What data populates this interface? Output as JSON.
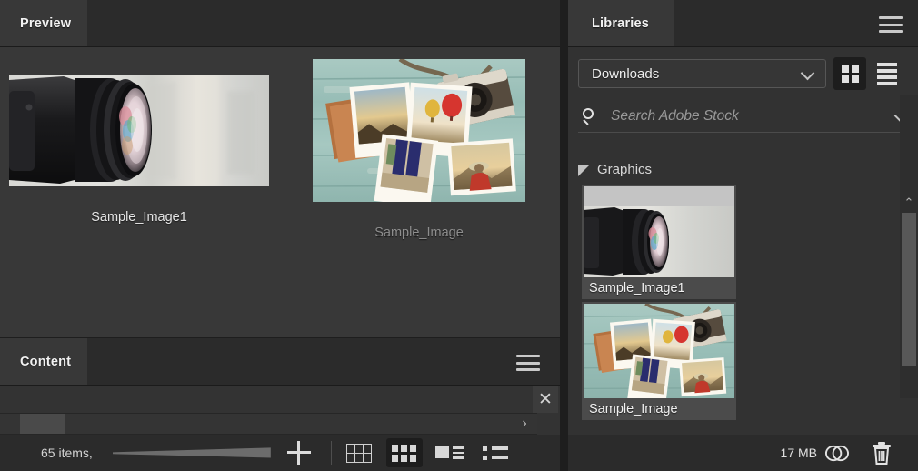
{
  "preview_panel": {
    "tab_label": "Preview",
    "menu_icon": "hamburger-icon",
    "items": [
      {
        "caption": "Sample_Image1",
        "image": "camera-lens-photo",
        "dim": false
      },
      {
        "caption": "Sample_Image",
        "image": "polaroid-photos-photo",
        "dim": true
      }
    ]
  },
  "content_panel": {
    "tab_label": "Content",
    "menu_icon": "hamburger-icon",
    "close_label": "✕",
    "scroll_left_label": "‹",
    "scroll_right_label": "›",
    "items_count": "65 items,",
    "add_label": "+",
    "view_modes": [
      {
        "name": "grid-lines-view",
        "active": false
      },
      {
        "name": "thumbnail-grid-view",
        "active": true
      },
      {
        "name": "details-view",
        "active": false
      },
      {
        "name": "list-view",
        "active": false
      }
    ]
  },
  "libraries_panel": {
    "tab_label": "Libraries",
    "menu_icon": "hamburger-icon",
    "library_selected": "Downloads",
    "library_options": [
      "Downloads"
    ],
    "view_toggles": [
      {
        "name": "grid-view-toggle",
        "active": true
      },
      {
        "name": "list-view-toggle",
        "active": false
      }
    ],
    "search": {
      "placeholder": "Search Adobe Stock",
      "value": "",
      "icon": "search-icon",
      "chevron": "chevron-down-icon"
    },
    "group": {
      "label": "Graphics",
      "expanded": true
    },
    "assets": [
      {
        "name": "Sample_Image1",
        "image": "camera-lens-photo"
      },
      {
        "name": "Sample_Image",
        "image": "polaroid-photos-photo"
      }
    ],
    "footer": {
      "size": "17 MB",
      "cloud_icon": "creative-cloud-icon",
      "delete_icon": "trash-icon"
    },
    "scrollbar": {
      "up_label": "⌃",
      "down_label": "⌄"
    }
  },
  "colors": {
    "panel_bg": "#2b2b2b",
    "body_bg": "#383838",
    "tab_active_bg": "#383838",
    "accent_selected": "#1d1d1d",
    "text_primary": "#f0f0f0",
    "text_dim": "#8e8e8e"
  }
}
